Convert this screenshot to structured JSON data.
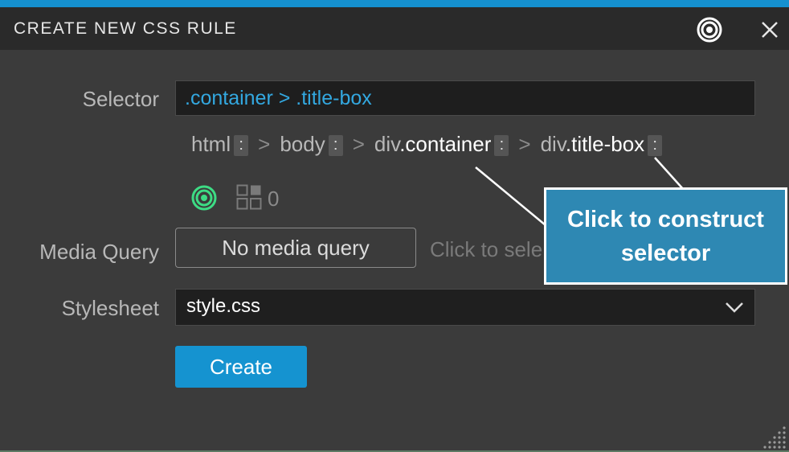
{
  "dialog": {
    "title": "CREATE NEW CSS RULE"
  },
  "selector": {
    "label": "Selector",
    "value": ".container > .title-box",
    "breadcrumb": [
      {
        "tag": "html",
        "cls": ""
      },
      {
        "tag": "body",
        "cls": ""
      },
      {
        "tag": "div",
        "cls": ".container"
      },
      {
        "tag": "div",
        "cls": ".title-box"
      }
    ],
    "separator": ">",
    "kebab": ":",
    "match_count": "0"
  },
  "media_query": {
    "label": "Media Query",
    "button_label": "No media query",
    "hint": "Click to sele"
  },
  "stylesheet": {
    "label": "Stylesheet",
    "value": "style.css"
  },
  "create_button": {
    "label": "Create"
  },
  "callout": {
    "text": "Click to construct selector"
  },
  "colors": {
    "accent": "#1593d0",
    "selector_text": "#33a8e0",
    "target_green": "#3ddc84",
    "callout_bg": "#2e88b3"
  },
  "icons": {
    "title_target": "target-icon",
    "close": "close-icon",
    "green_target": "target-icon",
    "grid": "grid-icon",
    "dropdown": "chevron-down-icon",
    "resize": "resize-grip-icon"
  }
}
